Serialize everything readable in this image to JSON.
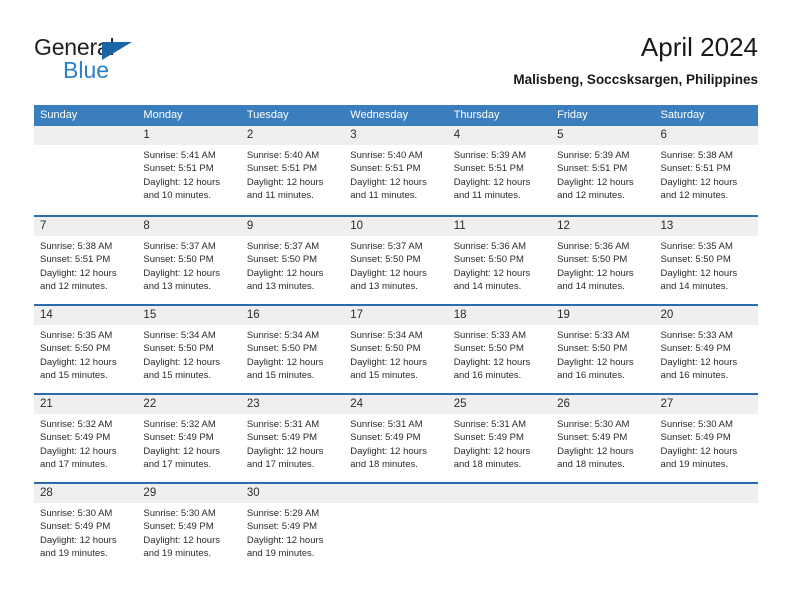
{
  "brand": {
    "name_top": "General",
    "name_bottom": "Blue",
    "triangle_color": "#1b64a5",
    "blue_text_color": "#2a7fc9"
  },
  "header": {
    "title": "April 2024",
    "subtitle": "Malisbeng, Soccsksargen, Philippines"
  },
  "theme": {
    "header_bg": "#3a7ebd",
    "week_divider": "#2d6ca8",
    "day_number_bg": "#efefef",
    "text_color": "#2b2b2b"
  },
  "weekdays": [
    "Sunday",
    "Monday",
    "Tuesday",
    "Wednesday",
    "Thursday",
    "Friday",
    "Saturday"
  ],
  "weeks": [
    [
      {
        "day": "",
        "empty": true,
        "sunrise": "",
        "sunset": "",
        "daylight_1": "",
        "daylight_2": ""
      },
      {
        "day": "1",
        "sunrise": "Sunrise: 5:41 AM",
        "sunset": "Sunset: 5:51 PM",
        "daylight_1": "Daylight: 12 hours",
        "daylight_2": "and 10 minutes."
      },
      {
        "day": "2",
        "sunrise": "Sunrise: 5:40 AM",
        "sunset": "Sunset: 5:51 PM",
        "daylight_1": "Daylight: 12 hours",
        "daylight_2": "and 11 minutes."
      },
      {
        "day": "3",
        "sunrise": "Sunrise: 5:40 AM",
        "sunset": "Sunset: 5:51 PM",
        "daylight_1": "Daylight: 12 hours",
        "daylight_2": "and 11 minutes."
      },
      {
        "day": "4",
        "sunrise": "Sunrise: 5:39 AM",
        "sunset": "Sunset: 5:51 PM",
        "daylight_1": "Daylight: 12 hours",
        "daylight_2": "and 11 minutes."
      },
      {
        "day": "5",
        "sunrise": "Sunrise: 5:39 AM",
        "sunset": "Sunset: 5:51 PM",
        "daylight_1": "Daylight: 12 hours",
        "daylight_2": "and 12 minutes."
      },
      {
        "day": "6",
        "sunrise": "Sunrise: 5:38 AM",
        "sunset": "Sunset: 5:51 PM",
        "daylight_1": "Daylight: 12 hours",
        "daylight_2": "and 12 minutes."
      }
    ],
    [
      {
        "day": "7",
        "sunrise": "Sunrise: 5:38 AM",
        "sunset": "Sunset: 5:51 PM",
        "daylight_1": "Daylight: 12 hours",
        "daylight_2": "and 12 minutes."
      },
      {
        "day": "8",
        "sunrise": "Sunrise: 5:37 AM",
        "sunset": "Sunset: 5:50 PM",
        "daylight_1": "Daylight: 12 hours",
        "daylight_2": "and 13 minutes."
      },
      {
        "day": "9",
        "sunrise": "Sunrise: 5:37 AM",
        "sunset": "Sunset: 5:50 PM",
        "daylight_1": "Daylight: 12 hours",
        "daylight_2": "and 13 minutes."
      },
      {
        "day": "10",
        "sunrise": "Sunrise: 5:37 AM",
        "sunset": "Sunset: 5:50 PM",
        "daylight_1": "Daylight: 12 hours",
        "daylight_2": "and 13 minutes."
      },
      {
        "day": "11",
        "sunrise": "Sunrise: 5:36 AM",
        "sunset": "Sunset: 5:50 PM",
        "daylight_1": "Daylight: 12 hours",
        "daylight_2": "and 14 minutes."
      },
      {
        "day": "12",
        "sunrise": "Sunrise: 5:36 AM",
        "sunset": "Sunset: 5:50 PM",
        "daylight_1": "Daylight: 12 hours",
        "daylight_2": "and 14 minutes."
      },
      {
        "day": "13",
        "sunrise": "Sunrise: 5:35 AM",
        "sunset": "Sunset: 5:50 PM",
        "daylight_1": "Daylight: 12 hours",
        "daylight_2": "and 14 minutes."
      }
    ],
    [
      {
        "day": "14",
        "sunrise": "Sunrise: 5:35 AM",
        "sunset": "Sunset: 5:50 PM",
        "daylight_1": "Daylight: 12 hours",
        "daylight_2": "and 15 minutes."
      },
      {
        "day": "15",
        "sunrise": "Sunrise: 5:34 AM",
        "sunset": "Sunset: 5:50 PM",
        "daylight_1": "Daylight: 12 hours",
        "daylight_2": "and 15 minutes."
      },
      {
        "day": "16",
        "sunrise": "Sunrise: 5:34 AM",
        "sunset": "Sunset: 5:50 PM",
        "daylight_1": "Daylight: 12 hours",
        "daylight_2": "and 15 minutes."
      },
      {
        "day": "17",
        "sunrise": "Sunrise: 5:34 AM",
        "sunset": "Sunset: 5:50 PM",
        "daylight_1": "Daylight: 12 hours",
        "daylight_2": "and 15 minutes."
      },
      {
        "day": "18",
        "sunrise": "Sunrise: 5:33 AM",
        "sunset": "Sunset: 5:50 PM",
        "daylight_1": "Daylight: 12 hours",
        "daylight_2": "and 16 minutes."
      },
      {
        "day": "19",
        "sunrise": "Sunrise: 5:33 AM",
        "sunset": "Sunset: 5:50 PM",
        "daylight_1": "Daylight: 12 hours",
        "daylight_2": "and 16 minutes."
      },
      {
        "day": "20",
        "sunrise": "Sunrise: 5:33 AM",
        "sunset": "Sunset: 5:49 PM",
        "daylight_1": "Daylight: 12 hours",
        "daylight_2": "and 16 minutes."
      }
    ],
    [
      {
        "day": "21",
        "sunrise": "Sunrise: 5:32 AM",
        "sunset": "Sunset: 5:49 PM",
        "daylight_1": "Daylight: 12 hours",
        "daylight_2": "and 17 minutes."
      },
      {
        "day": "22",
        "sunrise": "Sunrise: 5:32 AM",
        "sunset": "Sunset: 5:49 PM",
        "daylight_1": "Daylight: 12 hours",
        "daylight_2": "and 17 minutes."
      },
      {
        "day": "23",
        "sunrise": "Sunrise: 5:31 AM",
        "sunset": "Sunset: 5:49 PM",
        "daylight_1": "Daylight: 12 hours",
        "daylight_2": "and 17 minutes."
      },
      {
        "day": "24",
        "sunrise": "Sunrise: 5:31 AM",
        "sunset": "Sunset: 5:49 PM",
        "daylight_1": "Daylight: 12 hours",
        "daylight_2": "and 18 minutes."
      },
      {
        "day": "25",
        "sunrise": "Sunrise: 5:31 AM",
        "sunset": "Sunset: 5:49 PM",
        "daylight_1": "Daylight: 12 hours",
        "daylight_2": "and 18 minutes."
      },
      {
        "day": "26",
        "sunrise": "Sunrise: 5:30 AM",
        "sunset": "Sunset: 5:49 PM",
        "daylight_1": "Daylight: 12 hours",
        "daylight_2": "and 18 minutes."
      },
      {
        "day": "27",
        "sunrise": "Sunrise: 5:30 AM",
        "sunset": "Sunset: 5:49 PM",
        "daylight_1": "Daylight: 12 hours",
        "daylight_2": "and 19 minutes."
      }
    ],
    [
      {
        "day": "28",
        "sunrise": "Sunrise: 5:30 AM",
        "sunset": "Sunset: 5:49 PM",
        "daylight_1": "Daylight: 12 hours",
        "daylight_2": "and 19 minutes."
      },
      {
        "day": "29",
        "sunrise": "Sunrise: 5:30 AM",
        "sunset": "Sunset: 5:49 PM",
        "daylight_1": "Daylight: 12 hours",
        "daylight_2": "and 19 minutes."
      },
      {
        "day": "30",
        "sunrise": "Sunrise: 5:29 AM",
        "sunset": "Sunset: 5:49 PM",
        "daylight_1": "Daylight: 12 hours",
        "daylight_2": "and 19 minutes."
      },
      {
        "day": "",
        "empty": true,
        "sunrise": "",
        "sunset": "",
        "daylight_1": "",
        "daylight_2": ""
      },
      {
        "day": "",
        "empty": true,
        "sunrise": "",
        "sunset": "",
        "daylight_1": "",
        "daylight_2": ""
      },
      {
        "day": "",
        "empty": true,
        "sunrise": "",
        "sunset": "",
        "daylight_1": "",
        "daylight_2": ""
      },
      {
        "day": "",
        "empty": true,
        "sunrise": "",
        "sunset": "",
        "daylight_1": "",
        "daylight_2": ""
      }
    ]
  ]
}
